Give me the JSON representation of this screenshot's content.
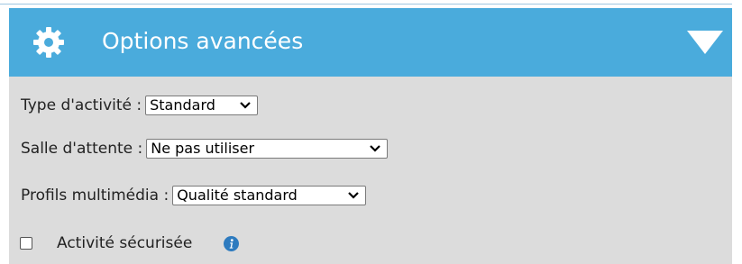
{
  "panel": {
    "title": "Options avancées",
    "header_color": "#4aabdc",
    "header_icon": "gear-icon",
    "collapse_icon": "triangle-down-icon"
  },
  "fields": {
    "activity_type": {
      "label": "Type d'activité :",
      "value": "Standard"
    },
    "waiting_room": {
      "label": "Salle d'attente :",
      "value": "Ne pas utiliser"
    },
    "media_profile": {
      "label": "Profils multimédia :",
      "value": "Qualité standard"
    },
    "secure_activity": {
      "label": "Activité sécurisée",
      "checked": false,
      "info_icon": "info-icon"
    }
  }
}
